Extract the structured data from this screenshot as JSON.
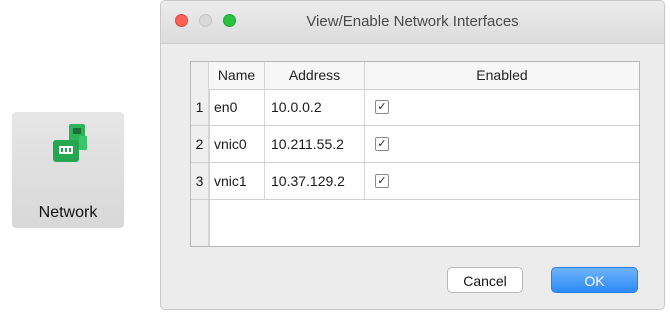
{
  "toolbar_tile": {
    "label": "Network",
    "icon": "network-icon",
    "accent": "#27b34b"
  },
  "window": {
    "title": "View/Enable Network Interfaces",
    "traffic_lights": {
      "close": "#fe5f57",
      "minimize": "#d8d8d8",
      "zoom": "#29c23f"
    }
  },
  "table": {
    "columns": [
      "Name",
      "Address",
      "Enabled"
    ],
    "rows": [
      {
        "num": "1",
        "name": "en0",
        "address": "10.0.0.2",
        "enabled": true,
        "check": "✓"
      },
      {
        "num": "2",
        "name": "vnic0",
        "address": "10.211.55.2",
        "enabled": true,
        "check": "✓"
      },
      {
        "num": "3",
        "name": "vnic1",
        "address": "10.37.129.2",
        "enabled": true,
        "check": "✓"
      }
    ]
  },
  "buttons": {
    "cancel": "Cancel",
    "ok": "OK",
    "ok_color": "#2e8af7"
  }
}
